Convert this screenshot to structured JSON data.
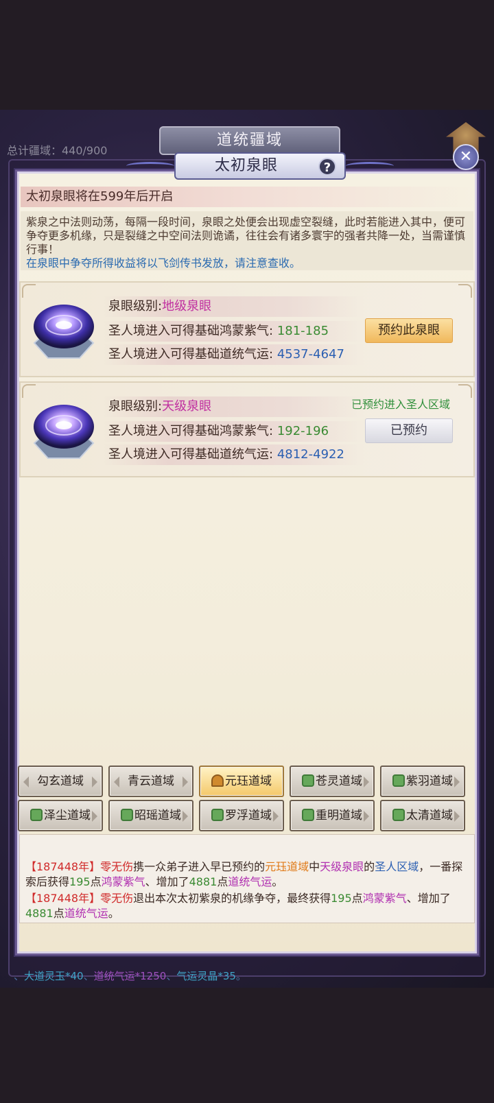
{
  "outer": {
    "title": "道统疆域",
    "stat": "总计疆域：440/900",
    "bottom_text_parts": [
      "、",
      "大道灵玉*40",
      "、",
      "道统气运*1250",
      "、",
      "气运灵晶*35",
      "。"
    ]
  },
  "panel": {
    "title": "太初泉眼",
    "help": "?",
    "close": "✕"
  },
  "notice": {
    "header": "太初泉眼将在599年后开启",
    "body": "紫泉之中法则动荡，每隔一段时间，泉眼之处便会出现虚空裂缝，此时若能进入其中，便可争夺更多机缘，只是裂缝之中空间法则诡谲，往往会有诸多寰宇的强者共降一处，当需谨慎行事！",
    "mail_note": "在泉眼中争夺所得收益将以飞剑传书发放，请注意查收。"
  },
  "springs": [
    {
      "level_label": "泉眼级别:",
      "level": "地级泉眼",
      "qi_label": "圣人境进入可得基础鸿蒙紫气:",
      "qi_range": "181-185",
      "fortune_label": "圣人境进入可得基础道统气运:",
      "fortune_range": "4537-4647",
      "button": "预约此泉眼",
      "note": ""
    },
    {
      "level_label": "泉眼级别:",
      "level": "天级泉眼",
      "qi_label": "圣人境进入可得基础鸿蒙紫气:",
      "qi_range": "192-196",
      "fortune_label": "圣人境进入可得基础道统气运:",
      "fortune_range": "4812-4922",
      "button": "已预约",
      "note": "已预约进入圣人区域"
    }
  ],
  "tabs": [
    {
      "label": "勾玄道域",
      "icon": "none",
      "active": false
    },
    {
      "label": "青云道域",
      "icon": "none",
      "active": false
    },
    {
      "label": "元珏道域",
      "icon": "sage-icon",
      "active": true
    },
    {
      "label": "苍灵道域",
      "icon": "shield-icon",
      "active": false
    },
    {
      "label": "紫羽道域",
      "icon": "shield-icon",
      "active": false
    },
    {
      "label": "泽尘道域",
      "icon": "shield-icon",
      "active": false
    },
    {
      "label": "昭瑶道域",
      "icon": "shield-icon",
      "active": false
    },
    {
      "label": "罗浮道域",
      "icon": "shield-icon",
      "active": false
    },
    {
      "label": "重明道域",
      "icon": "shield-icon",
      "active": false
    },
    {
      "label": "太清道域",
      "icon": "shield-icon",
      "active": false
    }
  ],
  "log": {
    "line1": {
      "year": "【187448年】",
      "name": "零无伤",
      "t1": "携一众弟子进入早已预约的",
      "domain": "元珏道域",
      "t2": "中",
      "spring": "天级泉眼",
      "t3": "的",
      "zone": "圣人区域",
      "t4": "，一番探索后获得",
      "qi_amount": "195",
      "t5": "点",
      "qi_name": "鸿蒙紫气",
      "t6": "、增加了",
      "fortune_amount": "4881",
      "t7": "点",
      "fortune_name": "道统气运",
      "t8": "。"
    },
    "line2": {
      "year": "【187448年】",
      "name": "零无伤",
      "t1": "退出本次太初紫泉的机缘争夺，最终获得",
      "qi_amount": "195",
      "t2": "点",
      "qi_name": "鸿蒙紫气",
      "t3": "、增加了",
      "fortune_amount": "4881",
      "t4": "点",
      "fortune_name": "道统气运",
      "t5": "。"
    }
  }
}
